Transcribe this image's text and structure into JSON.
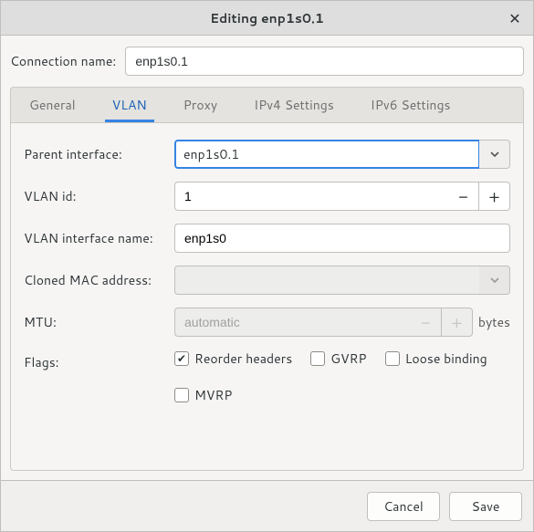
{
  "window": {
    "title": "Editing enp1s0.1"
  },
  "connection": {
    "label": "Connection name:",
    "value": "enp1s0.1"
  },
  "tabs": {
    "general": "General",
    "vlan": "VLAN",
    "proxy": "Proxy",
    "ipv4": "IPv4 Settings",
    "ipv6": "IPv6 Settings"
  },
  "vlan": {
    "parent_label": "Parent interface:",
    "parent_value": "enp1s0.1",
    "vlanid_label": "VLAN id:",
    "vlanid_value": "1",
    "ifname_label": "VLAN interface name:",
    "ifname_value": "enp1s0",
    "mac_label": "Cloned MAC address:",
    "mac_value": "",
    "mtu_label": "MTU:",
    "mtu_value": "automatic",
    "mtu_unit": "bytes",
    "flags_label": "Flags:",
    "flags": {
      "reorder": {
        "label": "Reorder headers",
        "checked": true
      },
      "gvrp": {
        "label": "GVRP",
        "checked": false
      },
      "loose": {
        "label": "Loose binding",
        "checked": false
      },
      "mvrp": {
        "label": "MVRP",
        "checked": false
      }
    }
  },
  "footer": {
    "cancel": "Cancel",
    "save": "Save"
  }
}
